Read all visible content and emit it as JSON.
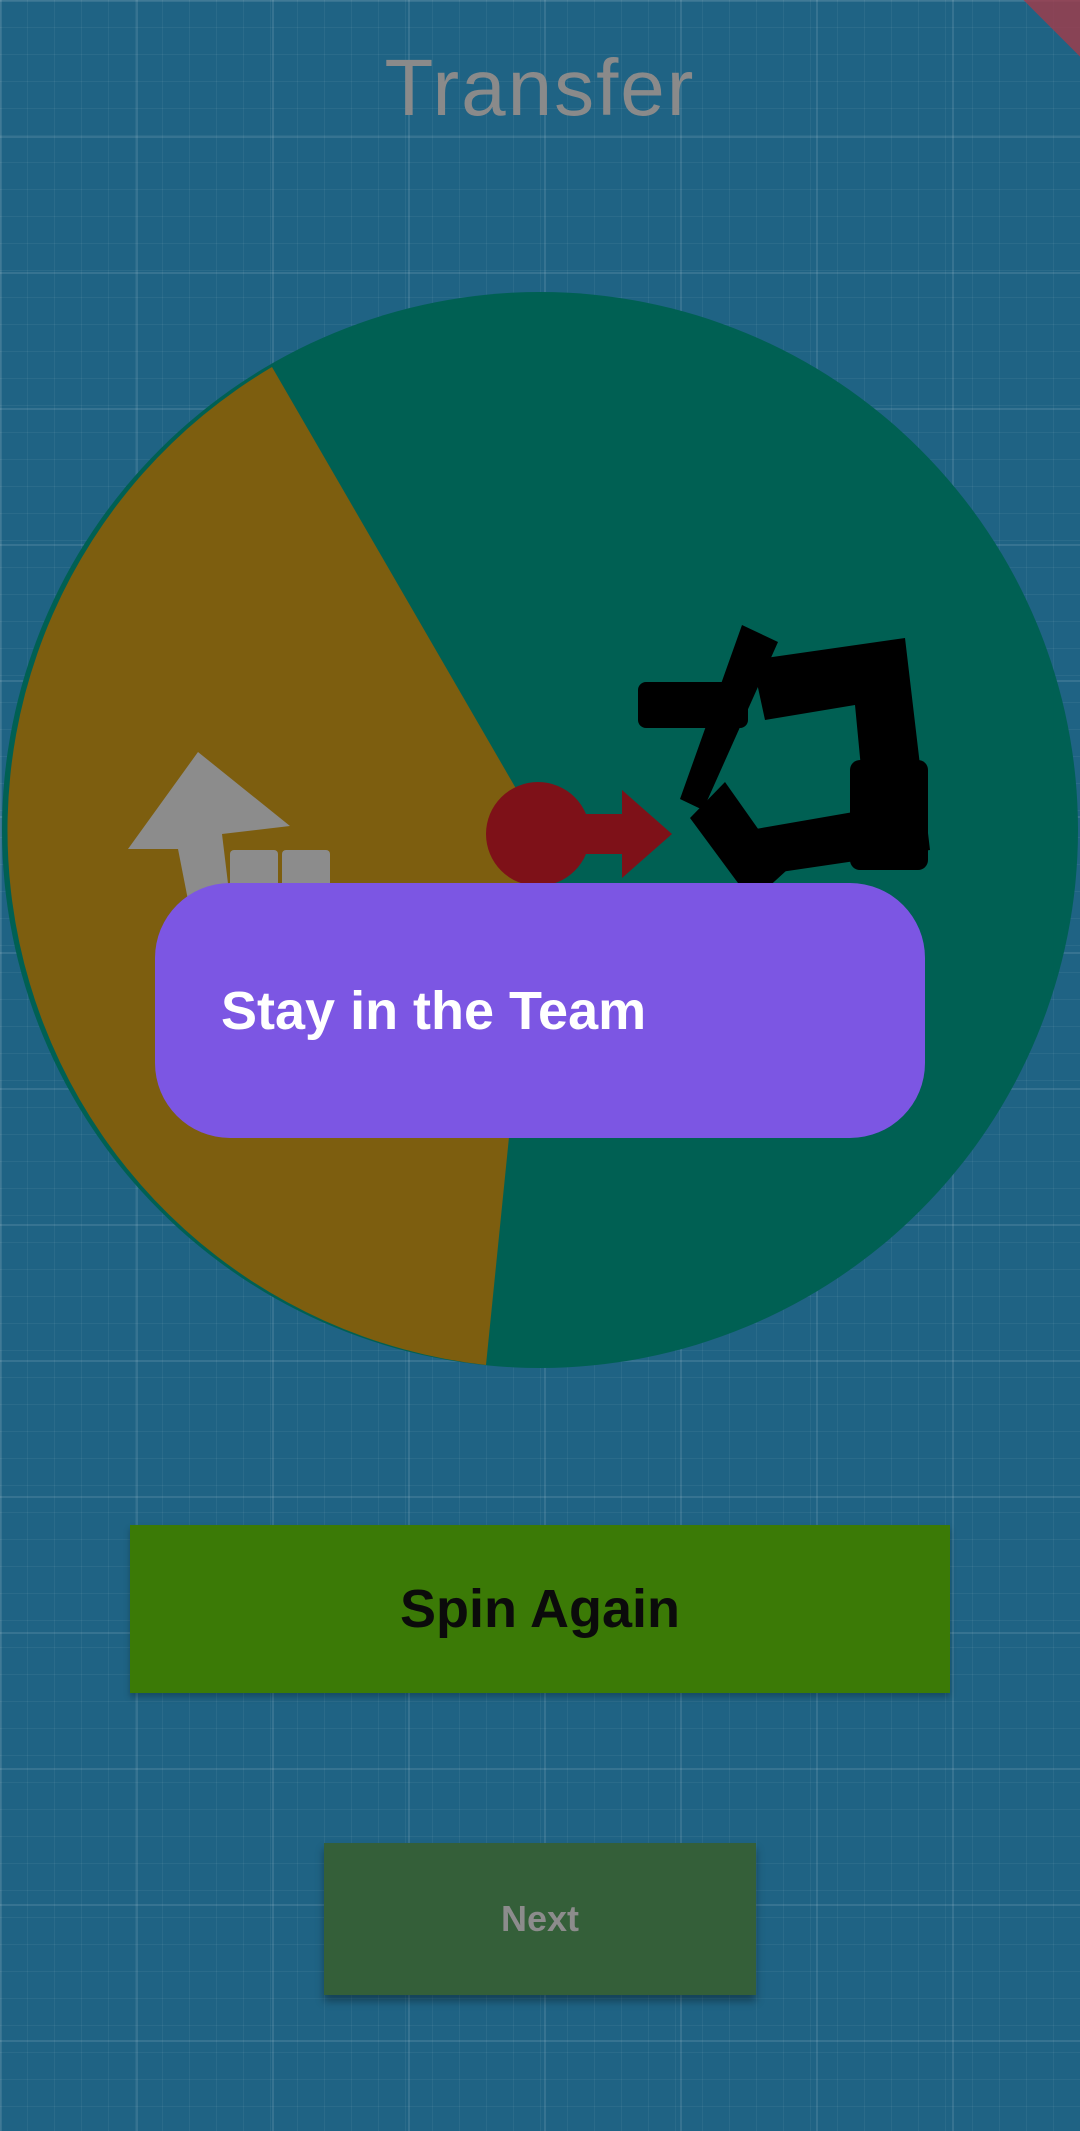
{
  "header": {
    "title": "Transfer"
  },
  "wheel": {
    "segments": [
      {
        "color": "#7d5e0f",
        "icon": "arrow-up-transfer-icon"
      },
      {
        "color": "#006053",
        "icon": "stay-team-icon"
      }
    ],
    "pointer_color": "#7e1118"
  },
  "result": {
    "text": "Stay in the Team"
  },
  "actions": {
    "spin_again_label": "Spin Again",
    "next_label": "Next"
  }
}
